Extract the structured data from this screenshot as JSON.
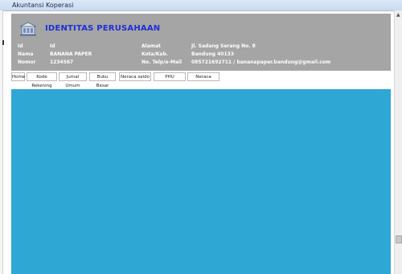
{
  "window": {
    "title": "Akuntansi Koperasi"
  },
  "header": {
    "title": "IDENTITAS PERUSAHAAN",
    "fields_left": [
      {
        "label": "Id",
        "value": "Id"
      },
      {
        "label": "Nama",
        "value": "BANANA PAPER"
      },
      {
        "label": "Nomor",
        "value": "1234567"
      }
    ],
    "fields_right": [
      {
        "label": "Alamat",
        "value": "Jl. Sadang Serang No. 8"
      },
      {
        "label": "Kota/Kab.",
        "value": "Bandung 40133"
      },
      {
        "label": "No. Telp/e-Mail",
        "value": "085721692711 / bananapaper.bandung@gmail.com"
      }
    ]
  },
  "menu": {
    "items": [
      {
        "label": "Home"
      },
      {
        "label": "Kode Rekening"
      },
      {
        "label": "Jurnal Umum"
      },
      {
        "label": "Buku Besar"
      },
      {
        "label": "Neraca saldo"
      },
      {
        "label": "PHU"
      },
      {
        "label": "Neraca"
      }
    ]
  },
  "colors": {
    "header_bg": "#a5a5a5",
    "title_color": "#1f2fd6",
    "content_bg": "#2ea7d4"
  }
}
